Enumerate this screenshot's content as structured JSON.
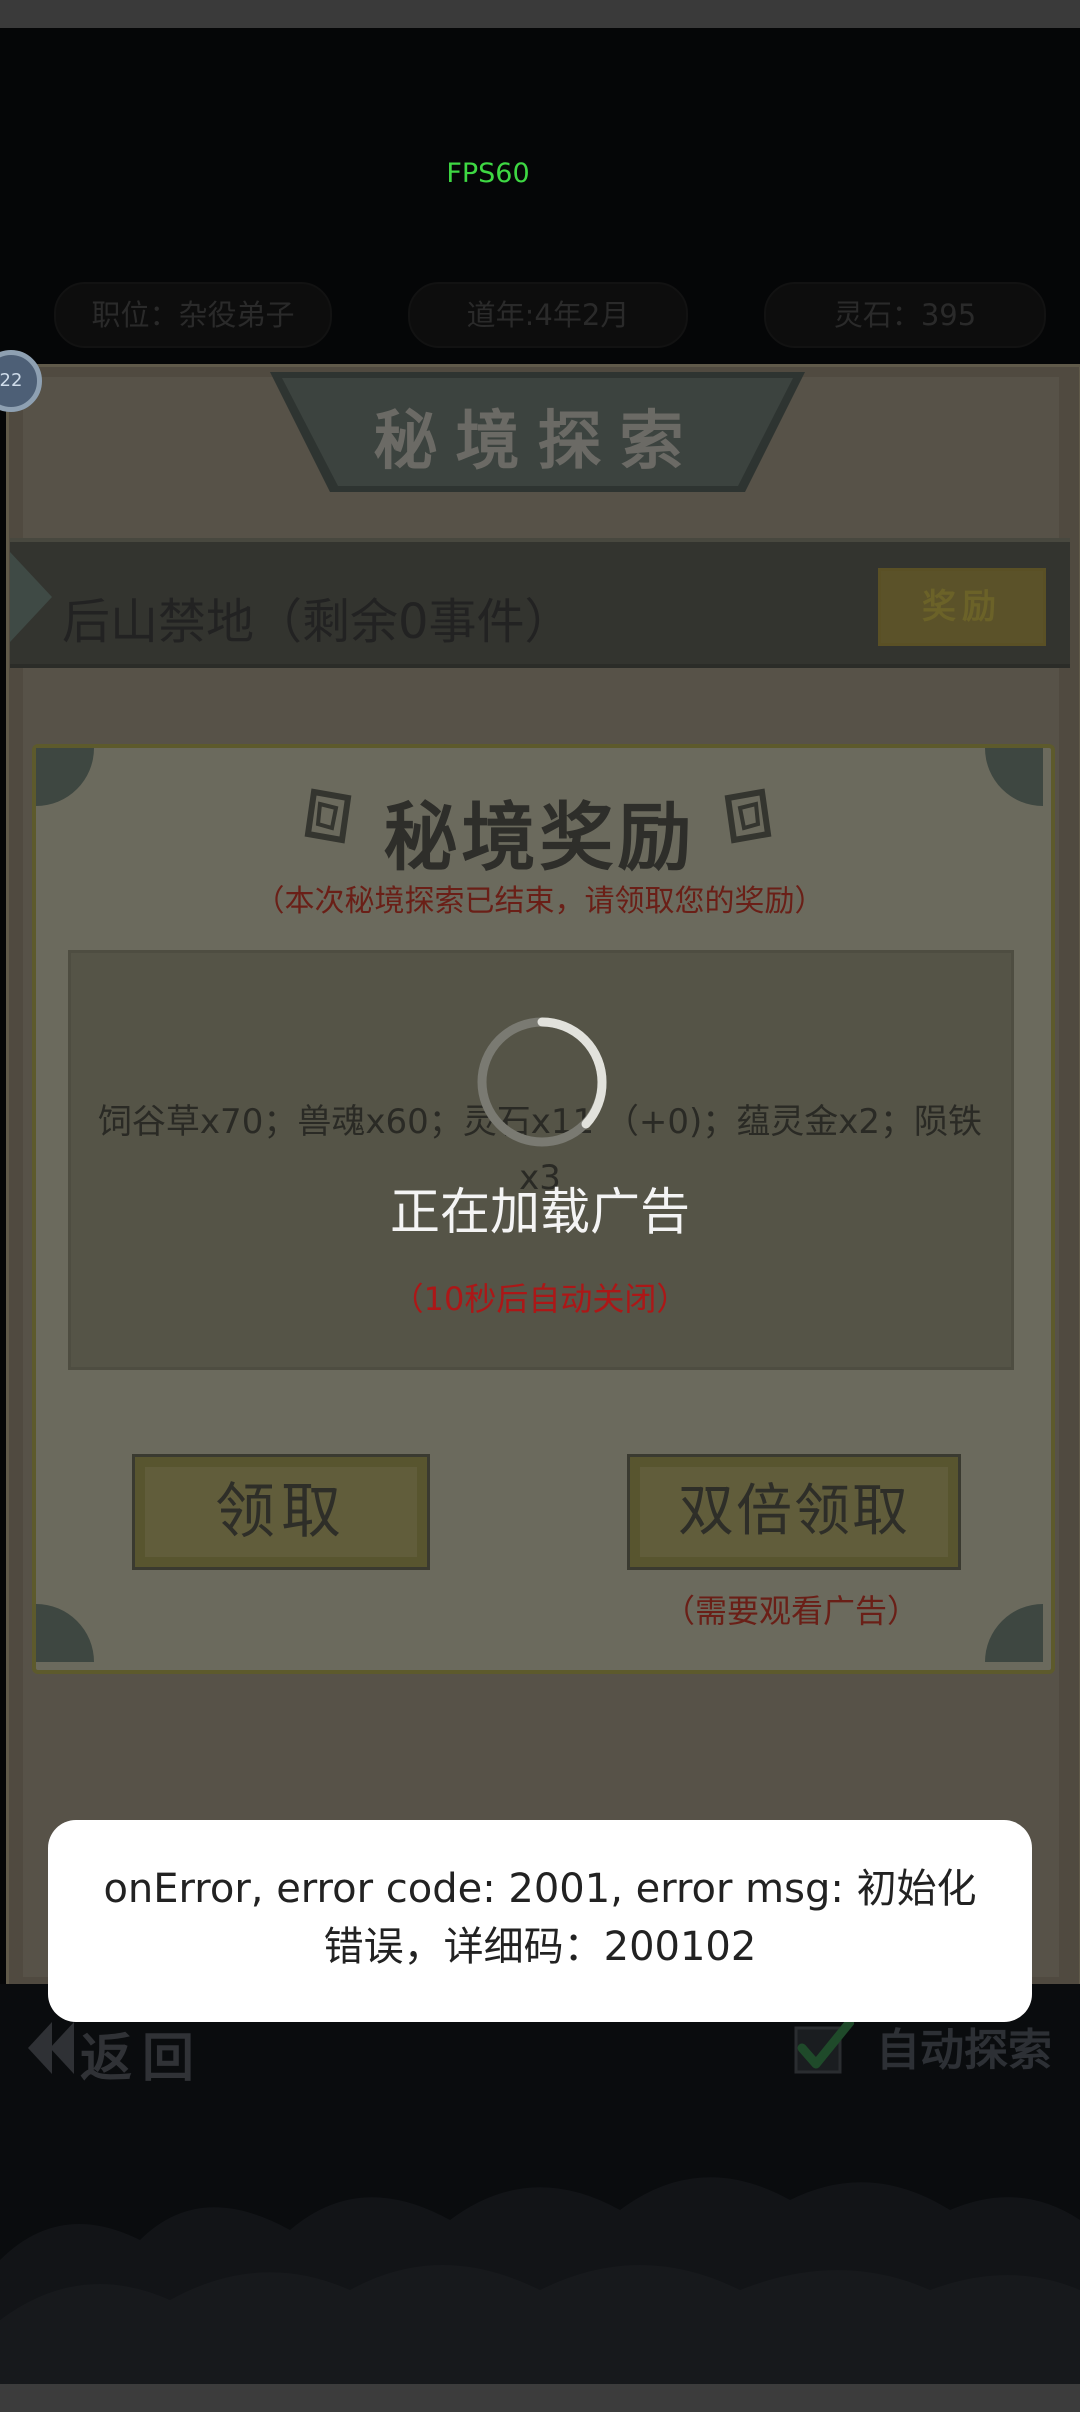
{
  "fps": "FPS60",
  "stats": {
    "position": "职位：杂役弟子",
    "year": "道年:4年2月",
    "spirit_stone": "灵石：395"
  },
  "level_badge": "22",
  "page_title": "秘境探索",
  "location": {
    "name": "后山禁地（剩余0事件）",
    "reward_button": "奖励"
  },
  "dialog": {
    "title": "秘境奖励",
    "subtitle": "（本次秘境探索已结束，请领取您的奖励）",
    "rewards": "饲谷草x70；兽魂x60；灵石x11 （+0)；蕴灵金x2；陨铁x3",
    "claim_button": "领取",
    "double_button": "双倍领取",
    "double_note": "（需要观看广告）"
  },
  "loading": {
    "text": "正在加载广告",
    "countdown": "（10秒后自动关闭）"
  },
  "nav": {
    "back": "返回",
    "auto_explore": "自动探索"
  },
  "toast": {
    "message": "onError, error code: 2001, error msg: 初始化错误，详细码：200102"
  }
}
